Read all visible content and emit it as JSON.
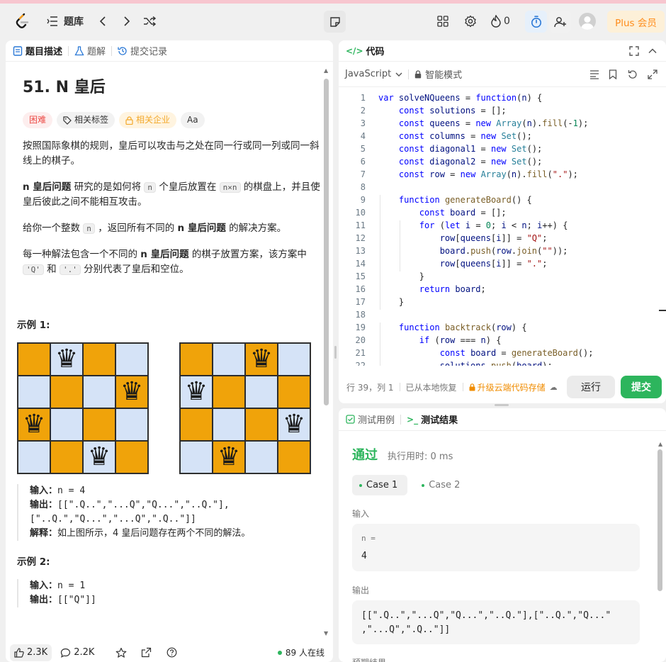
{
  "nav": {
    "problem_bank": "题库",
    "streak_count": "0",
    "plus_label": "Plus 会员"
  },
  "left_tabs": {
    "description": "题目描述",
    "solutions": "题解",
    "submissions": "提交记录"
  },
  "problem": {
    "title": "51. N 皇后",
    "difficulty": "困难",
    "tags_label": "相关标签",
    "company_label": "相关企业",
    "font_label": "Aa",
    "p1": "按照国际象棋的规则，皇后可以攻击与之处在同一行或同一列或同一斜线上的棋子。",
    "p2_bold": "n 皇后问题",
    "p2_a": " 研究的是如何将 ",
    "p2_code1": "n",
    "p2_b": " 个皇后放置在 ",
    "p2_code2": "n×n",
    "p2_c": " 的棋盘上，并且使皇后彼此之间不能相互攻击。",
    "p3_a": "给你一个整数 ",
    "p3_code": "n",
    "p3_b": " ，返回所有不同的 ",
    "p3_bold": "n 皇后问题",
    "p3_c": " 的解决方案。",
    "p4_a": "每一种解法包含一个不同的 ",
    "p4_bold": "n 皇后问题",
    "p4_b": " 的棋子放置方案，该方案中 ",
    "p4_code1": "'Q'",
    "p4_c": " 和 ",
    "p4_code2": "'.'",
    "p4_d": " 分别代表了皇后和空位。",
    "example1_heading": "示例 1:",
    "example1_input_label": "输入：",
    "example1_input": "n = 4",
    "example1_output_label": "输出：",
    "example1_output_l1": "[[\".Q..\",\"...Q\",\"Q...\",\"..Q.\"],",
    "example1_output_l2": "[\"..Q.\",\"Q...\",\"...Q\",\".Q..\"]]",
    "example1_expl_label": "解释：",
    "example1_expl": "如上图所示，4 皇后问题存在两个不同的解法。",
    "example2_heading": "示例 2:",
    "example2_input_label": "输入：",
    "example2_input": "n = 1",
    "example2_output_label": "输出：",
    "example2_output": "[[\"Q\"]]"
  },
  "boards": [
    {
      "queens": [
        1,
        3,
        0,
        2
      ]
    },
    {
      "queens": [
        2,
        0,
        3,
        1
      ]
    }
  ],
  "footer": {
    "likes": "2.3K",
    "comments": "2.2K",
    "online": "89 人在线"
  },
  "code_panel": {
    "title": "代码",
    "language": "JavaScript",
    "mode": "智能模式",
    "status_pos": "行 39，列 1",
    "status_saved": "已从本地恢复",
    "upgrade_label": "升级云端代码存储",
    "run_label": "运行",
    "submit_label": "提交",
    "lines": [
      "var solveNQueens = function(n) {",
      "    const solutions = [];",
      "    const queens = new Array(n).fill(-1);",
      "    const columns = new Set();",
      "    const diagonal1 = new Set();",
      "    const diagonal2 = new Set();",
      "    const row = new Array(n).fill(\".\");",
      "",
      "    function generateBoard() {",
      "        const board = [];",
      "        for (let i = 0; i < n; i++) {",
      "            row[queens[i]] = \"Q\";",
      "            board.push(row.join(\"\"));",
      "            row[queens[i]] = \".\";",
      "        }",
      "        return board;",
      "    }",
      "",
      "    function backtrack(row) {",
      "        if (row === n) {",
      "            const board = generateBoard();",
      "            solutions.push(board);"
    ]
  },
  "result_panel": {
    "tab_cases": "测试用例",
    "tab_result": "测试结果",
    "status": "通过",
    "runtime": "执行用时: 0 ms",
    "case1": "Case 1",
    "case2": "Case 2",
    "input_label": "输入",
    "input_var": "n =",
    "input_value": "4",
    "output_label": "输出",
    "output_l1": "[[\".Q..\",\"...Q\",\"Q...\",\"..Q.\"],[\"..Q.\",\"Q...\"",
    "output_l2": ",\"...Q\",\".Q..\"]]",
    "expected_label": "预期结果"
  },
  "colors": {
    "accent_green": "#2db55d",
    "hard_red": "#ec4c47",
    "board_orange": "#f0a30a",
    "board_blue": "#d5e3f7",
    "plus_orange": "#ff8c1a"
  }
}
